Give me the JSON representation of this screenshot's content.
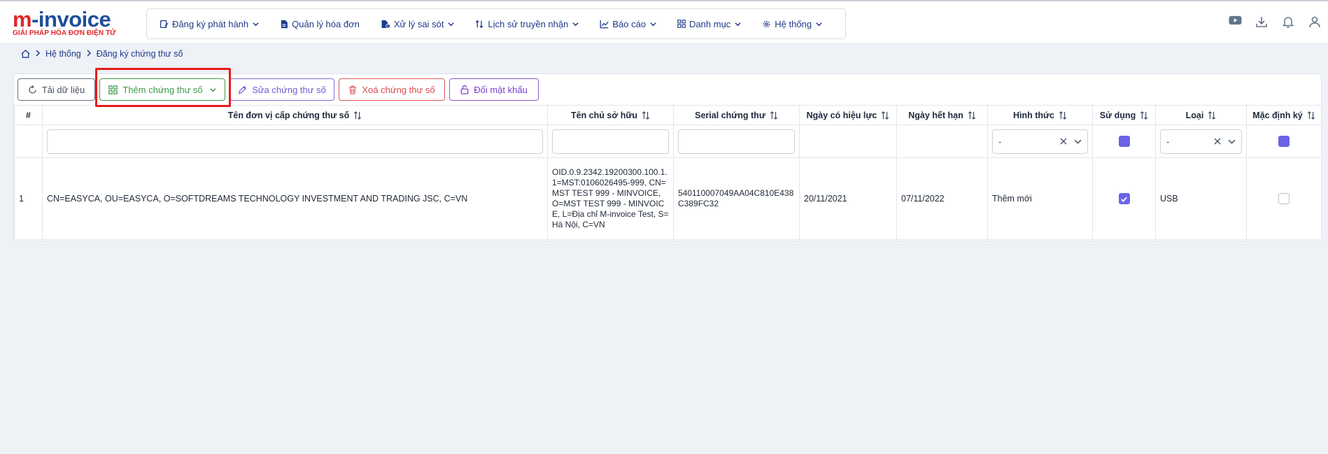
{
  "brand": {
    "logo_m": "m",
    "logo_rest": "-invoice",
    "tagline": "GIẢI PHÁP HÓA ĐƠN ĐIỆN TỬ"
  },
  "nav": {
    "items": [
      {
        "label": "Đăng ký phát hành",
        "icon": "edit-doc-icon",
        "dropdown": true
      },
      {
        "label": "Quản lý hóa đơn",
        "icon": "file-icon",
        "dropdown": false
      },
      {
        "label": "Xử lý sai sót",
        "icon": "file-error-icon",
        "dropdown": true
      },
      {
        "label": "Lịch sử truyền nhận",
        "icon": "sort-arrows-icon",
        "dropdown": true
      },
      {
        "label": "Báo cáo",
        "icon": "chart-line-icon",
        "dropdown": true
      },
      {
        "label": "Danh mục",
        "icon": "grid-icon",
        "dropdown": true
      },
      {
        "label": "Hệ thống",
        "icon": "gear-icon",
        "dropdown": true
      }
    ]
  },
  "top_icons": [
    "youtube-icon",
    "download-icon",
    "bell-icon",
    "user-icon"
  ],
  "breadcrumb": {
    "home_icon": "home-icon",
    "items": [
      "Hệ thống",
      "Đăng ký chứng thư số"
    ]
  },
  "toolbar": {
    "reload": "Tải dữ liệu",
    "add": "Thêm chứng thư số",
    "edit": "Sửa chứng thư số",
    "delete": "Xoá chứng thư số",
    "change_password": "Đổi mật khẩu"
  },
  "table": {
    "columns": [
      "#",
      "Tên đơn vị cấp chứng thư số",
      "Tên chủ sở hữu",
      "Serial chứng thư",
      "Ngày có hiệu lực",
      "Ngày hết hạn",
      "Hình thức",
      "Sử dụng",
      "Loại",
      "Mặc định ký"
    ],
    "filters": {
      "hinh_thuc": "-",
      "loai": "-"
    },
    "rows": [
      {
        "index": "1",
        "issuer": "CN=EASYCA, OU=EASYCA, O=SOFTDREAMS TECHNOLOGY INVESTMENT AND TRADING JSC, C=VN",
        "owner": "OID.0.9.2342.19200300.100.1.1=MST:0106026495-999, CN=MST TEST 999 - MINVOICE, O=MST TEST 999 - MINVOICE, L=Địa chỉ M-invoice Test, S=Hà Nội, C=VN",
        "serial": "540110007049AA04C810E438C389FC32",
        "valid_from": "20/11/2021",
        "valid_to": "07/11/2022",
        "form": "Thêm mới",
        "in_use": true,
        "type": "USB",
        "default_sign": false
      }
    ]
  },
  "colors": {
    "primary_nav": "#1e3a8a",
    "checkbox": "#6b63e8",
    "highlight": "#e61c1c"
  }
}
